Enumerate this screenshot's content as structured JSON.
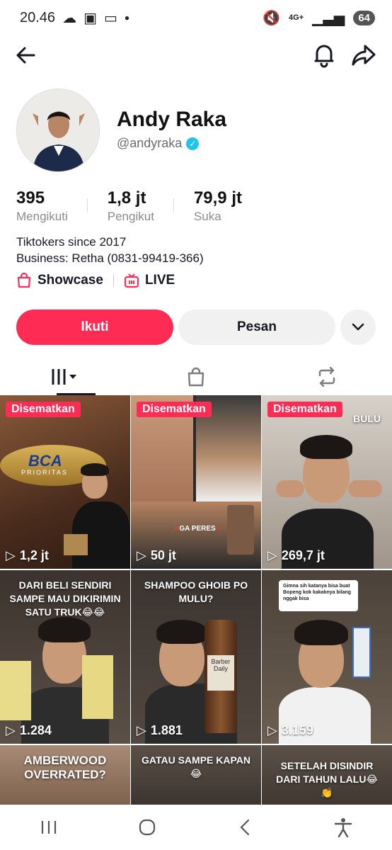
{
  "status_bar": {
    "time": "20.46",
    "network": "4G+",
    "battery": "64"
  },
  "profile": {
    "name": "Andy Raka",
    "handle": "@andyraka",
    "stats": [
      {
        "value": "395",
        "label": "Mengikuti"
      },
      {
        "value": "1,8 jt",
        "label": "Pengikut"
      },
      {
        "value": "79,9 jt",
        "label": "Suka"
      }
    ],
    "bio_line1": "Tiktokers since 2017",
    "bio_line2": "Business: Retha (0831-99419-366)",
    "links": {
      "showcase": "Showcase",
      "live": "LIVE"
    }
  },
  "actions": {
    "follow": "Ikuti",
    "message": "Pesan"
  },
  "videos": [
    {
      "pinned": "Disematkan",
      "views": "1,2 jt",
      "caption": ""
    },
    {
      "pinned": "Disematkan",
      "views": "50 jt",
      "caption": ""
    },
    {
      "pinned": "Disematkan",
      "views": "269,7 jt",
      "caption": "BULU"
    },
    {
      "pinned": "",
      "views": "1.284",
      "caption": "DARI BELI SENDIRI SAMPE MAU DIKIRIMIN SATU TRUK😂😂"
    },
    {
      "pinned": "",
      "views": "1.881",
      "caption": "SHAMPOO GHOIB PO MULU?"
    },
    {
      "pinned": "",
      "views": "3.159",
      "caption": ""
    },
    {
      "pinned": "",
      "views": "",
      "caption": "AMBERWOOD OVERRATED?"
    },
    {
      "pinned": "",
      "views": "",
      "caption": "GATAU SAMPE KAPAN😂"
    },
    {
      "pinned": "",
      "views": "",
      "caption": "SETELAH DISINDIR DARI TAHUN LALU😂👏"
    }
  ],
  "thumb_text": {
    "bca_logo": "BCA",
    "bca_sub": "PRIORITAS",
    "ga_peres": "GA PERES",
    "bottle_label": "Barber Daily",
    "comment_line": "Gimna sih katanya bisa buat Bopeng kok kakaknya bilang nggak bisa"
  },
  "colors": {
    "accent": "#fe2c55",
    "verified": "#20c5ef"
  }
}
